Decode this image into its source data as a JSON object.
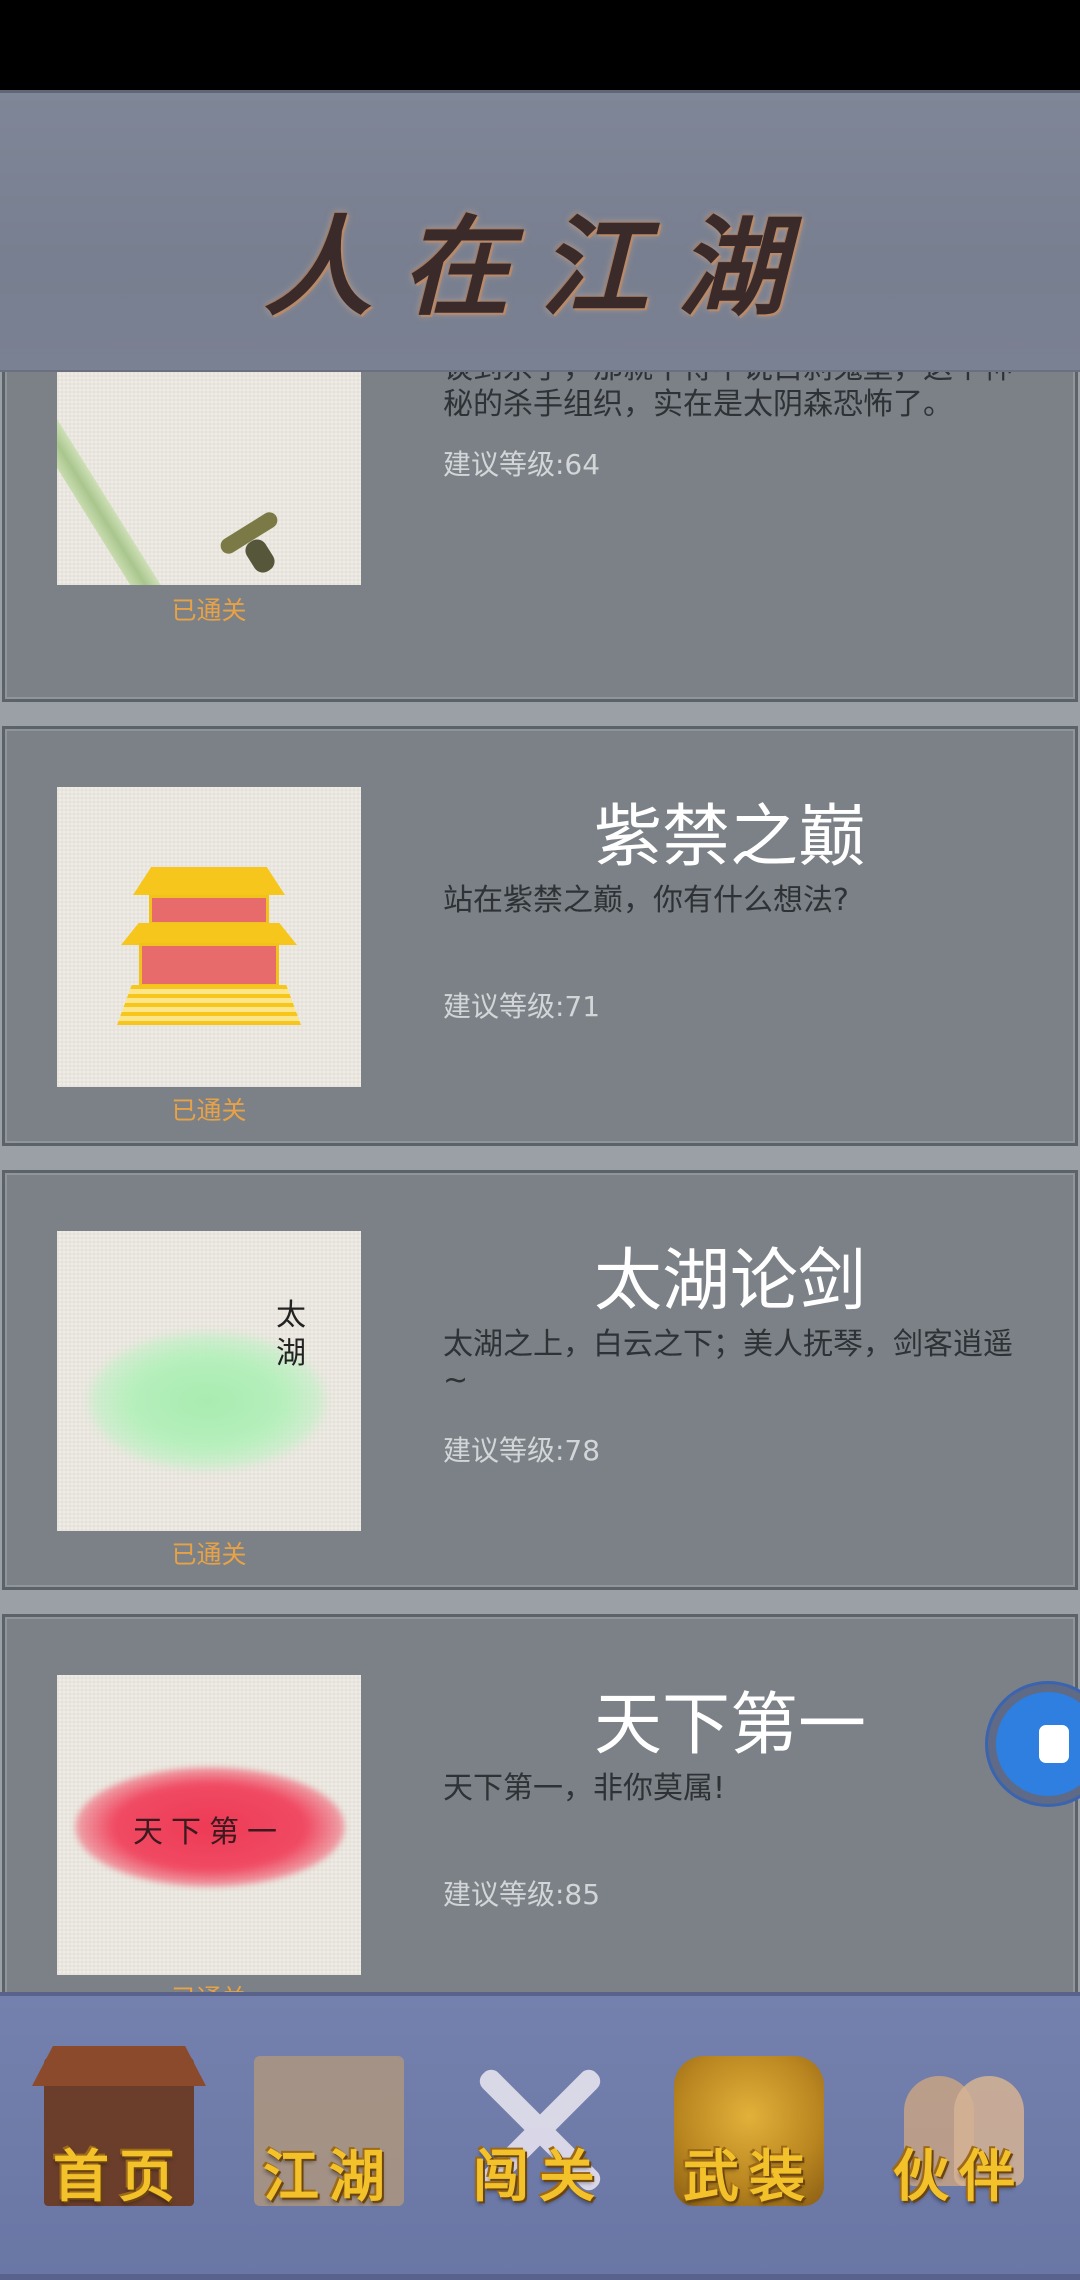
{
  "header": {
    "title": "人在江湖"
  },
  "levels": [
    {
      "title": "",
      "description": "谈到杀手，那就不得不说白刹鬼堡，这个神秘的杀手组织，实在是太阴森恐怖了。",
      "level_text": "建议等级:64",
      "status": "已通关",
      "thumb_icon": "sword-icon"
    },
    {
      "title": "紫禁之巅",
      "description": "站在紫禁之巅，你有什么想法?",
      "level_text": "建议等级:71",
      "status": "已通关",
      "thumb_icon": "palace-icon"
    },
    {
      "title": "太湖论剑",
      "description": "太湖之上，白云之下；美人抚琴，剑客逍遥~",
      "level_text": "建议等级:78",
      "status": "已通关",
      "thumb_icon": "lake-icon",
      "thumb_text": "太湖"
    },
    {
      "title": "天下第一",
      "description": "天下第一，非你莫属!",
      "level_text": "建议等级:85",
      "status": "已通关",
      "thumb_icon": "number-one-icon",
      "thumb_text": "天下第一"
    }
  ],
  "float_button": {
    "icon": "assistant-icon"
  },
  "tabs": [
    {
      "label": "首页",
      "icon": "home-icon"
    },
    {
      "label": "江湖",
      "icon": "scroll-icon"
    },
    {
      "label": "闯关",
      "icon": "crossed-swords-icon"
    },
    {
      "label": "武装",
      "icon": "armor-icon"
    },
    {
      "label": "伙伴",
      "icon": "partners-icon"
    }
  ],
  "colors": {
    "status": "#e8a245",
    "title": "#ffffff",
    "tab_label": "#f3c22b"
  }
}
